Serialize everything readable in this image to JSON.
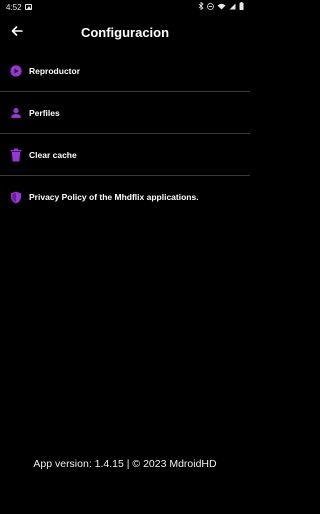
{
  "status_bar": {
    "time": "4:52"
  },
  "app_bar": {
    "title": "Configuracion"
  },
  "colors": {
    "accent": "#9b36d6",
    "background": "#000000",
    "divider": "#3a3a3a"
  },
  "settings": {
    "items": [
      {
        "label": "Reproductor",
        "icon": "play-circle-icon"
      },
      {
        "label": "Perfiles",
        "icon": "person-icon"
      },
      {
        "label": "Clear cache",
        "icon": "trash-icon"
      },
      {
        "label": "Privacy Policy of the Mhdflix applications.",
        "icon": "shield-icon"
      }
    ]
  },
  "footer": {
    "version_text": "App version: 1.4.15 | © 2023 MdroidHD"
  }
}
